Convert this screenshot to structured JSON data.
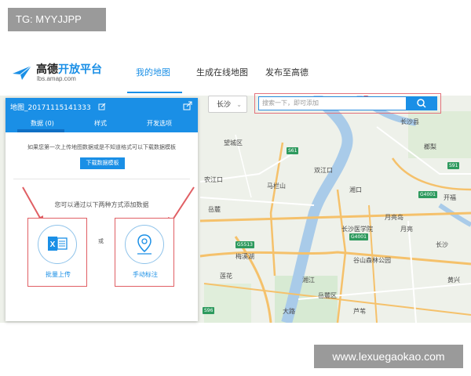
{
  "watermarks": {
    "top_left": "TG: MYYJJPP",
    "bottom_right": "www.lexuegaokao.com"
  },
  "header": {
    "logo_title": "高德",
    "logo_title_accent": "开放平台",
    "logo_sub": "lbs.amap.com",
    "nav": [
      {
        "label": "我的地图",
        "active": true
      },
      {
        "label": "生成在线地图",
        "active": false
      },
      {
        "label": "发布至高德",
        "active": false
      }
    ]
  },
  "city_selector": {
    "value": "长沙"
  },
  "search": {
    "placeholder": "搜索一下，即可添加"
  },
  "panel": {
    "title": "地图_20171115141333",
    "tabs": [
      {
        "label": "数据 (0)",
        "active": true
      },
      {
        "label": "样式",
        "active": false
      },
      {
        "label": "开发选项",
        "active": false
      }
    ],
    "hint": "如果您第一次上传地图数据或是不知道格式可以下载数据模板",
    "download_button": "下载数据模板",
    "methods_text": "您可以通过以下两种方式添加数据",
    "or_text": "或",
    "batch_upload_label": "批量上传",
    "manual_mark_label": "手动标注"
  },
  "map": {
    "labels": [
      "长沙县",
      "望城区",
      "双江口",
      "农江口",
      "马栏山",
      "月亮岛",
      "长沙医学院",
      "开福",
      "月亮",
      "长沙",
      "莲花",
      "谷山森林公园",
      "岳麓区",
      "湘江",
      "梅溪湖",
      "岳麓",
      "大路",
      "湘口",
      "芦苇",
      "榔梨",
      "黄兴"
    ],
    "road_badges": [
      "S61",
      "G4001",
      "G4001",
      "G5513",
      "S91",
      "S96"
    ]
  },
  "colors": {
    "accent": "#1a8fe6",
    "annotation_red": "#e05f64",
    "water": "#a9cbe9",
    "road_major": "#f5c16b"
  }
}
